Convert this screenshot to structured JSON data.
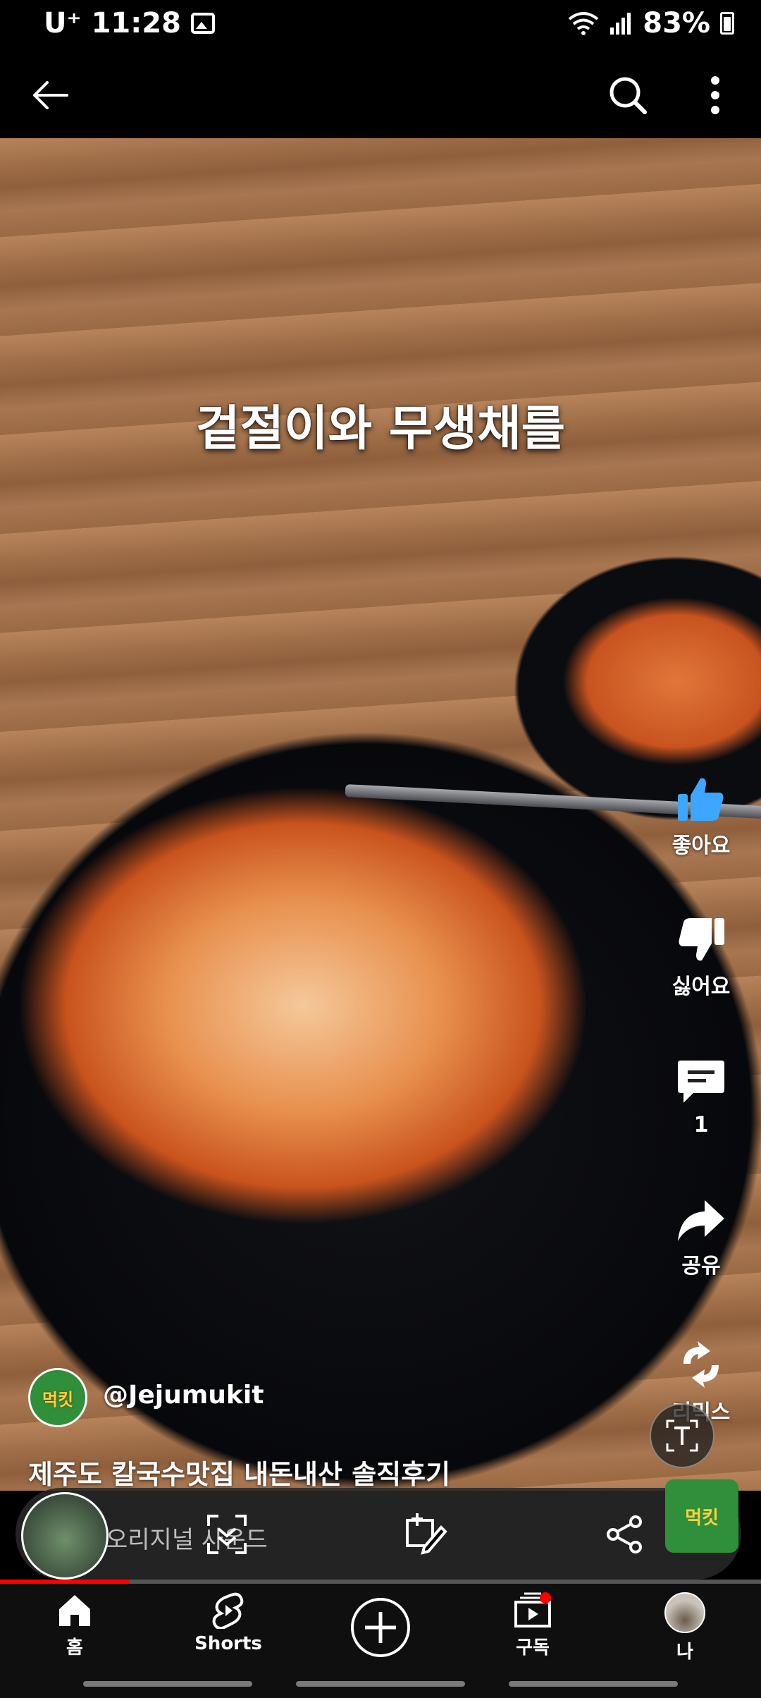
{
  "status_bar": {
    "carrier": "U⁺",
    "time": "11:28",
    "battery": "83%"
  },
  "video": {
    "caption_overlay": "겉절이와 무생채를",
    "channel_handle": "@Jejumukit",
    "channel_avatar_text": "먹킷",
    "title": "제주도 칼국수맛집 내돈내산 솔직후기",
    "progress": 0.17
  },
  "actions": {
    "like_label": "좋아요",
    "dislike_label": "싫어요",
    "comment_count": "1",
    "share_label": "공유",
    "remix_label": "리믹스"
  },
  "action_bar": {
    "text": "오리지널 사운드"
  },
  "sound_thumb_text": "먹킷",
  "nav": {
    "home": "홈",
    "shorts": "Shorts",
    "subscriptions": "구독",
    "me": "나"
  },
  "colors": {
    "like_accent": "#3ea6ff",
    "progress": "#ff0000",
    "notify_dot": "#ff0000"
  }
}
